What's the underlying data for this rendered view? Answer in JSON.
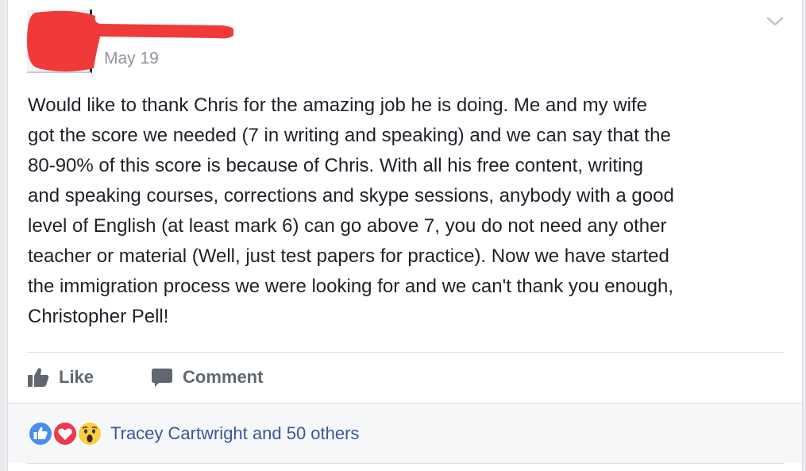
{
  "post": {
    "date": "May 19",
    "body": "Would like to thank Chris for the amazing job he is doing. Me and my wife\ngot the score we needed (7 in writing and speaking) and we can say that the\n80-90% of this score is because of Chris. With all his free content, writing\nand speaking courses, corrections and skype sessions, anybody with a good\nlevel of English (at least mark 6) can go above 7, you do not need any other\nteacher or material (Well, just test papers for practice). Now we have started\nthe immigration process we were looking for and we can't thank you enough,\nChristopher Pell!"
  },
  "actions": {
    "like_label": "Like",
    "comment_label": "Comment"
  },
  "reactions": {
    "icons": [
      "like-reaction-icon",
      "love-reaction-icon",
      "wow-reaction-icon"
    ],
    "summary": "Tracey Cartwright and 50 others"
  },
  "colors": {
    "background": "#e9ebee",
    "card": "#ffffff",
    "text": "#1d2129",
    "muted": "#90949c",
    "action": "#606770",
    "link": "#385898",
    "like_blue": "#4a8cf0",
    "love_red": "#f0384f",
    "wow_yellow": "#fccd45",
    "redaction": "#f03a3a"
  }
}
